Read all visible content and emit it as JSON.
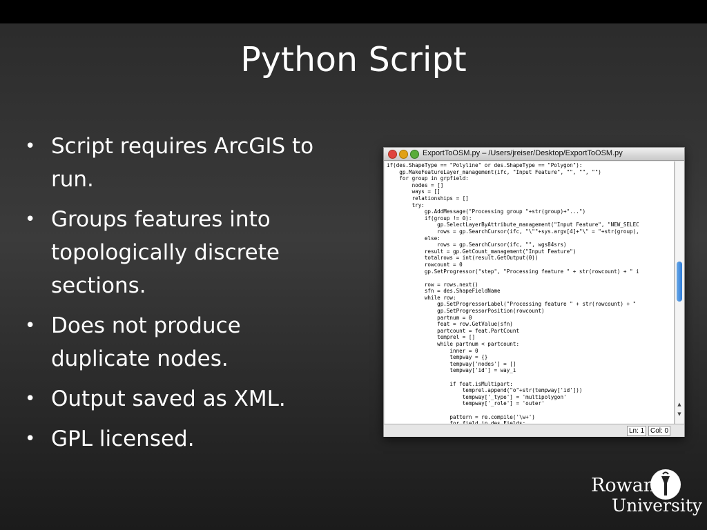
{
  "slide": {
    "title": "Python Script",
    "bullets": [
      "Script requires ArcGIS to run.",
      "Groups features into topologically discrete sections.",
      "Does not produce duplicate nodes.",
      "Output saved as XML.",
      "GPL licensed."
    ],
    "bullet_glyph": "•"
  },
  "window": {
    "title": "ExportToOSM.py – /Users/jreiser/Desktop/ExportToOSM.py",
    "code": "if(des.ShapeType == \"Polyline\" or des.ShapeType == \"Polygon\"):\n    gp.MakeFeatureLayer_management(ifc, \"Input Feature\", \"\", \"\", \"\")\n    for group in grpfield:\n        nodes = []\n        ways = []\n        relationships = []\n        try:\n            gp.AddMessage(\"Processing group \"+str(group)+\"...\")\n            if(group != 0):\n                gp.SelectLayerByAttribute_management(\"Input Feature\", \"NEW_SELEC\n                rows = gp.SearchCursor(ifc, \"\\\"\"+sys.argv[4]+\"\\\" = \"+str(group),\n            else:\n                rows = gp.SearchCursor(ifc, \"\", wgs84srs)\n            result = gp.GetCount_management(\"Input Feature\")\n            totalrows = int(result.GetOutput(0))\n            rowcount = 0\n            gp.SetProgressor(\"step\", \"Processing feature \" + str(rowcount) + \" i\n\n            row = rows.next()\n            sfn = des.ShapeFieldName\n            while row:\n                gp.SetProgressorLabel(\"Processing feature \" + str(rowcount) + \"\n                gp.SetProgressorPosition(rowcount)\n                partnum = 0\n                feat = row.GetValue(sfn)\n                partcount = feat.PartCount\n                temprel = []\n                while partnum < partcount:\n                    inner = 0\n                    tempway = {}\n                    tempway['nodes'] = []\n                    tempway['id'] = way_i\n\n                    if feat.isMultipart:\n                        temprel.append(\"o\"+str(tempway['id']))\n                        tempway['_type'] = 'multipolygon'\n                        tempway['_role'] = 'outer'\n\n                    pattern = re.compile('\\w+')\n                    for field in des.Fields:",
    "status_line": "Ln: 1",
    "status_col": "Col: 0",
    "scroll_up": "▲",
    "scroll_down": "▼"
  },
  "logo": {
    "line1": "Rowan",
    "line2": "University"
  }
}
